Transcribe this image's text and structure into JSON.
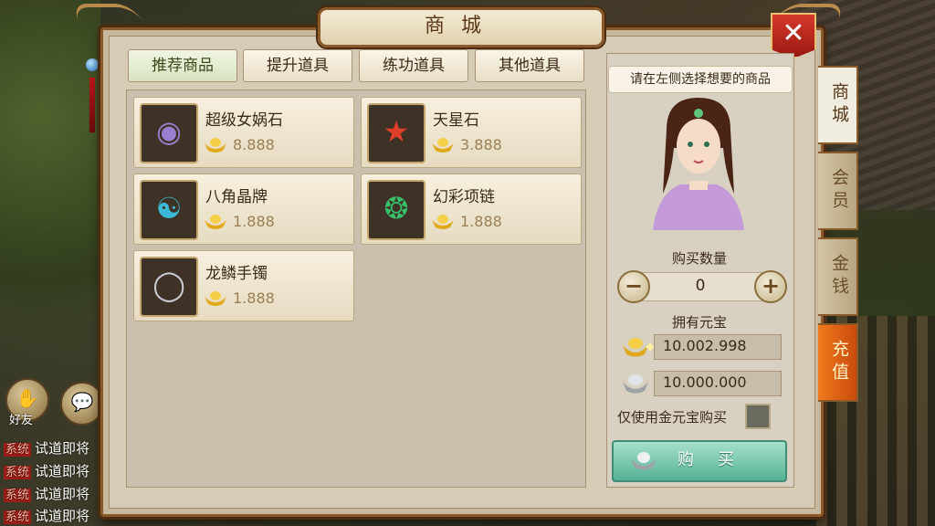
{
  "title": "商城",
  "categories": [
    "推荐商品",
    "提升道具",
    "练功道具",
    "其他道具"
  ],
  "items": [
    {
      "name": "超级女娲石",
      "price": "8.888",
      "icon": "purple-stone-icon"
    },
    {
      "name": "天星石",
      "price": "3.888",
      "icon": "red-star-stone-icon"
    },
    {
      "name": "八角晶牌",
      "price": "1.888",
      "icon": "bagua-tablet-icon"
    },
    {
      "name": "幻彩项链",
      "price": "1.888",
      "icon": "jade-necklace-icon"
    },
    {
      "name": "龙鳞手镯",
      "price": "1.888",
      "icon": "bracelet-icon"
    }
  ],
  "hint": "请在左侧选择想要的商品",
  "quantity": {
    "label": "购买数量",
    "value": "0"
  },
  "owned": {
    "label": "拥有元宝",
    "gold": "10.002.998",
    "silver": "10.000.000"
  },
  "gold_only_label": "仅使用金元宝购买",
  "buy_label": "购买",
  "side_tabs": [
    "商城",
    "会员",
    "金钱",
    "充值"
  ],
  "friend_label": "好友",
  "chat": [
    {
      "tag": "系统",
      "text": "试道即将"
    },
    {
      "tag": "系统",
      "text": "试道即将"
    },
    {
      "tag": "系统",
      "text": "试道即将"
    },
    {
      "tag": "系统",
      "text": "试道即将"
    }
  ],
  "colors": {
    "frame": "#8a5a2a",
    "buy": "#55b296",
    "recharge": "#e06a17",
    "close": "#c2261b"
  }
}
